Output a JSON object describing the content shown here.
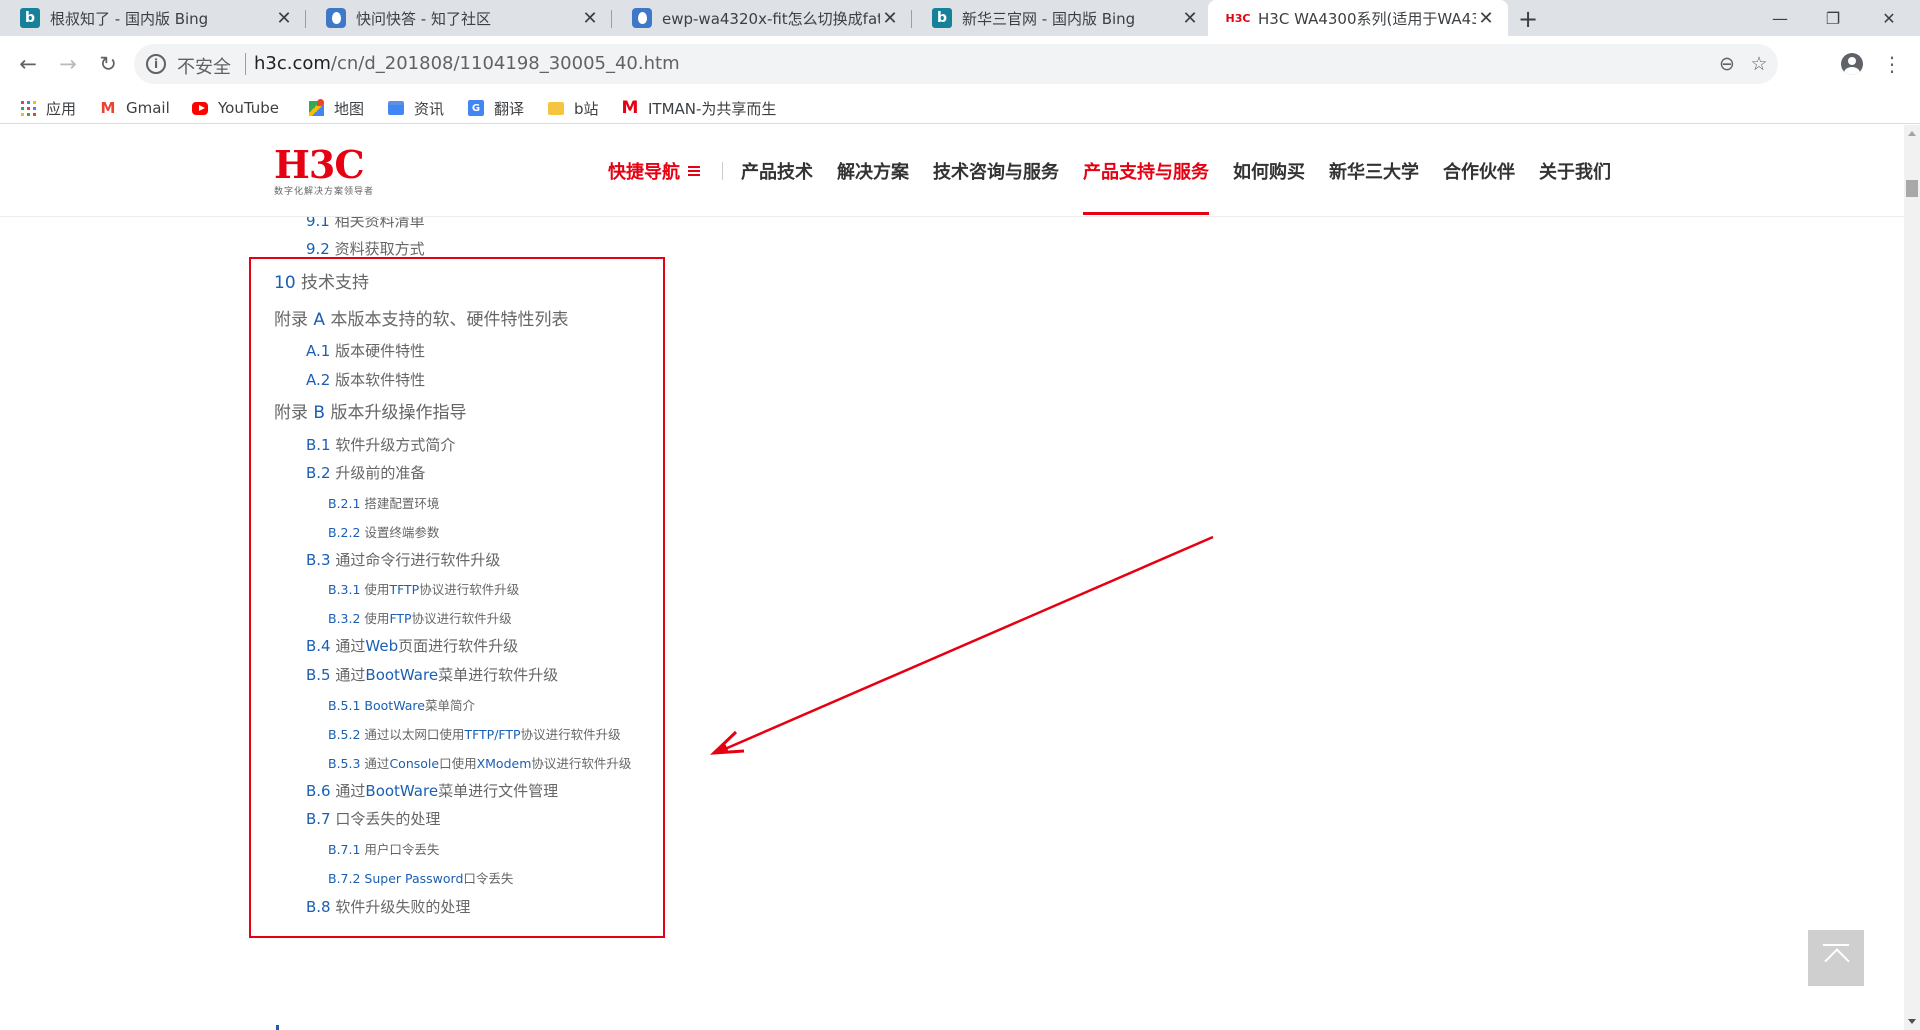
{
  "browser": {
    "tabs": [
      {
        "title": "根叔知了 - 国内版 Bing",
        "favicon": "bing-icon",
        "active": false
      },
      {
        "title": "快问快答 - 知了社区",
        "favicon": "zhiliao-icon",
        "active": false
      },
      {
        "title": "ewp-wa4320x-fit怎么切换成fat",
        "favicon": "zhiliao-icon",
        "active": false
      },
      {
        "title": "新华三官网 - 国内版 Bing",
        "favicon": "bing-icon",
        "active": false
      },
      {
        "title": "H3C WA4300系列(适用于WA43",
        "favicon": "h3c-icon",
        "active": true
      }
    ],
    "favicon_text": {
      "bing": "b",
      "h3c": "H3C"
    },
    "security_label": "不安全",
    "url_host": "h3c.com",
    "url_path": "/cn/d_201808/1104198_30005_40.htm",
    "bookmarks": [
      {
        "label": "应用",
        "icon": "apps-icon"
      },
      {
        "label": "Gmail",
        "icon": "gmail-icon"
      },
      {
        "label": "YouTube",
        "icon": "youtube-icon"
      },
      {
        "label": "地图",
        "icon": "maps-icon"
      },
      {
        "label": "资讯",
        "icon": "news-icon"
      },
      {
        "label": "翻译",
        "icon": "translate-icon"
      },
      {
        "label": "b站",
        "icon": "folder-icon"
      },
      {
        "label": "ITMAN-为共享而生",
        "icon": "itman-icon"
      }
    ],
    "bookmark_glyphs": {
      "gmail": "M",
      "translate": "G",
      "itman": "M"
    }
  },
  "site": {
    "logo": "H3C",
    "logo_tagline": "数字化解决方案领导者",
    "nav": [
      {
        "label": "快捷导航",
        "kind": "quick"
      },
      {
        "label": "产品技术"
      },
      {
        "label": "解决方案"
      },
      {
        "label": "技术咨询与服务"
      },
      {
        "label": "产品支持与服务",
        "active": true
      },
      {
        "label": "如何购买"
      },
      {
        "label": "新华三大学"
      },
      {
        "label": "合作伙伴"
      },
      {
        "label": "关于我们"
      }
    ]
  },
  "toc": {
    "above": [
      {
        "num": "9.1",
        "text": "相关资料清单"
      },
      {
        "num": "9.2",
        "text": "资料获取方式"
      }
    ],
    "s10": {
      "num": "10",
      "text": "技术支持"
    },
    "appA": {
      "pre": "附录",
      "num": "A",
      "text": "本版本支持的软、硬件特性列表"
    },
    "a1": {
      "num": "A.1",
      "text": "版本硬件特性"
    },
    "a2": {
      "num": "A.2",
      "text": "版本软件特性"
    },
    "appB": {
      "pre": "附录",
      "num": "B",
      "text": "版本升级操作指导"
    },
    "b1": {
      "num": "B.1",
      "text": "软件升级方式简介"
    },
    "b2": {
      "num": "B.2",
      "text": "升级前的准备"
    },
    "b21": {
      "num": "B.2.1",
      "text": "搭建配置环境"
    },
    "b22": {
      "num": "B.2.2",
      "text": "设置终端参数"
    },
    "b3": {
      "num": "B.3",
      "text": "通过命令行进行软件升级"
    },
    "b31": {
      "num": "B.3.1",
      "t1": "使用",
      "en": "TFTP",
      "t2": "协议进行软件升级"
    },
    "b32": {
      "num": "B.3.2",
      "t1": "使用",
      "en": "FTP",
      "t2": "协议进行软件升级"
    },
    "b4": {
      "num": "B.4",
      "t1": "通过",
      "en": "Web",
      "t2": "页面进行软件升级"
    },
    "b5": {
      "num": "B.5",
      "t1": "通过",
      "en": "BootWare",
      "t2": "菜单进行软件升级"
    },
    "b51": {
      "num": "B.5.1",
      "en": "BootWare",
      "t2": "菜单简介"
    },
    "b52": {
      "num": "B.5.2",
      "t1": "通过以太网口使用",
      "en": "TFTP/FTP",
      "t2": "协议进行软件升级"
    },
    "b53": {
      "num": "B.5.3",
      "t1": "通过",
      "en": "Console",
      "t2": "口使用",
      "en2": "XModem",
      "t3": "协议进行软件升级"
    },
    "b6": {
      "num": "B.6",
      "t1": "通过",
      "en": "BootWare",
      "t2": "菜单进行文件管理"
    },
    "b7": {
      "num": "B.7",
      "text": "口令丢失的处理"
    },
    "b71": {
      "num": "B.7.1",
      "text": "用户口令丢失"
    },
    "b72": {
      "num": "B.7.2",
      "en": "Super Password",
      "t2": "口令丢失"
    },
    "b8": {
      "num": "B.8",
      "text": "软件升级失败的处理"
    }
  },
  "annotation": {
    "color": "#e60012"
  },
  "colors": {
    "brand_red": "#e60012",
    "link_blue": "#1a5fb4",
    "tab_strip": "#dee1e6"
  }
}
